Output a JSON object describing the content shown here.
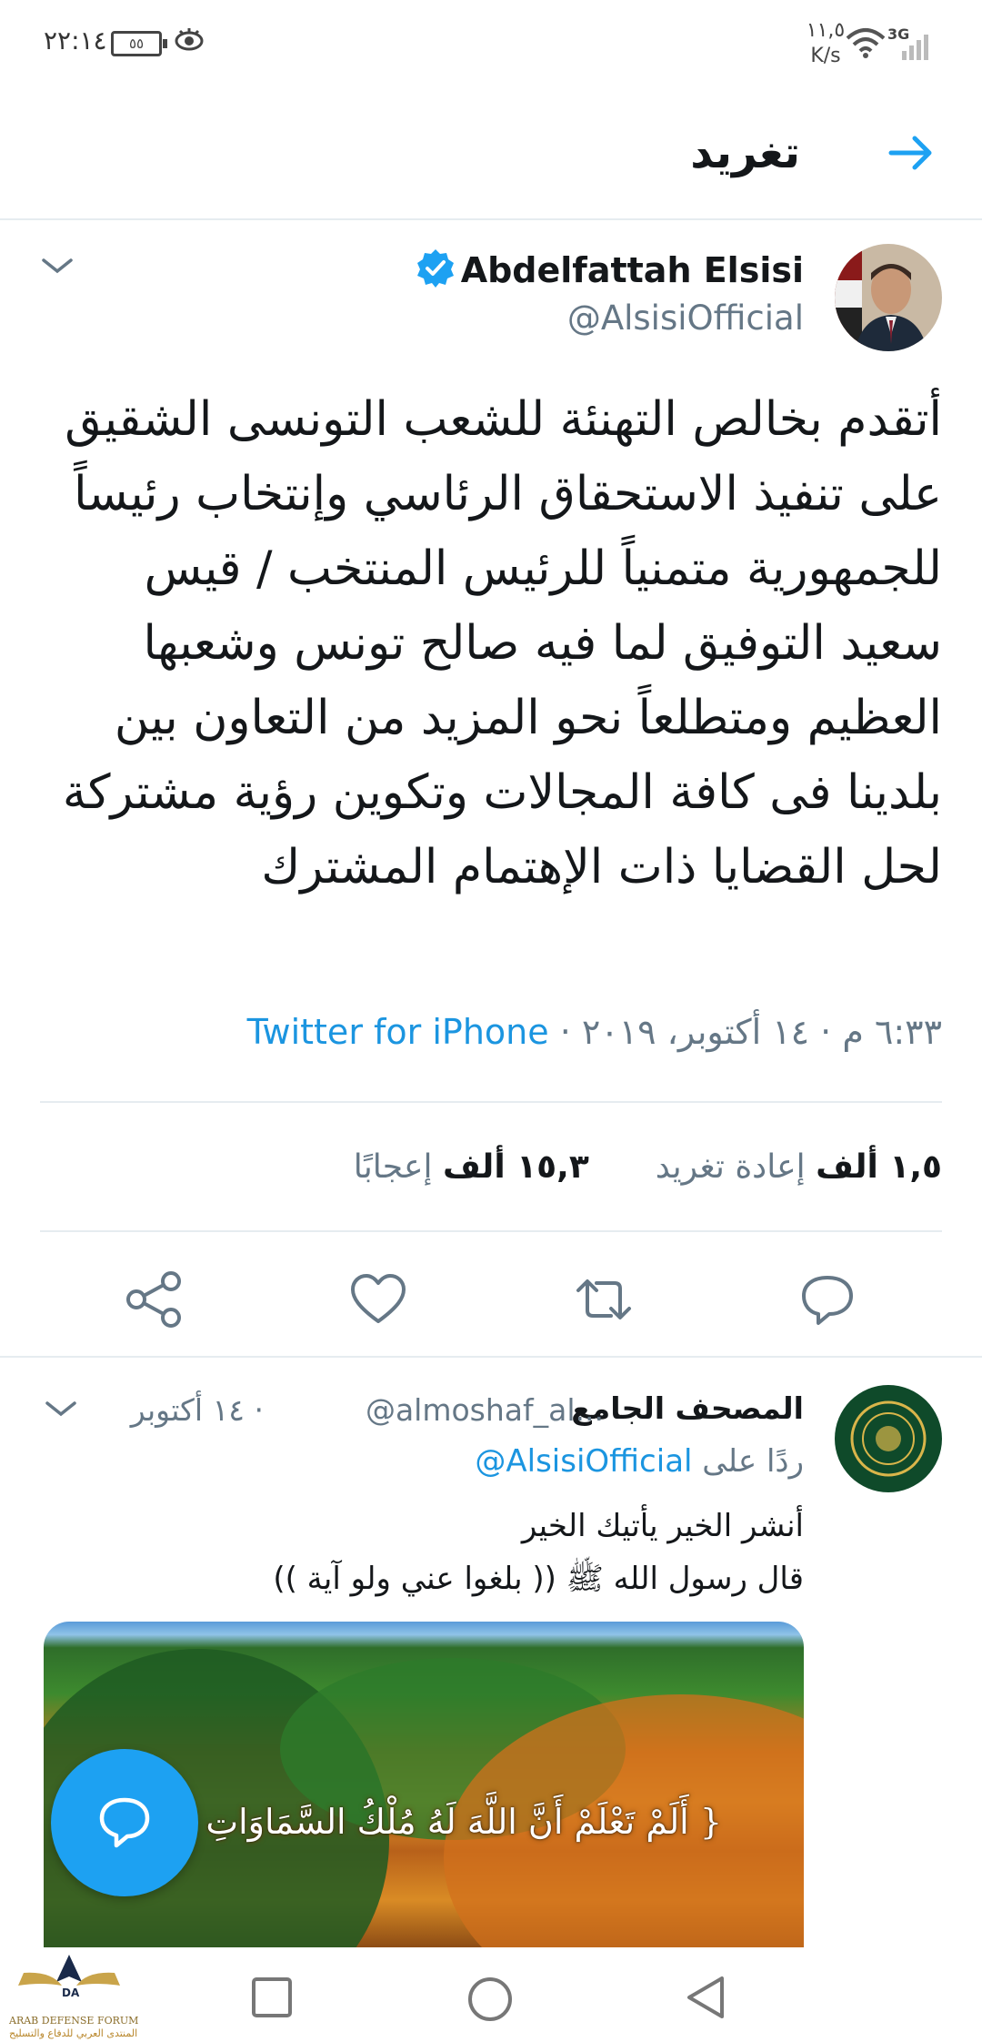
{
  "status_bar": {
    "time": "٢٢:١٤",
    "battery": "٥٥",
    "speed_value": "١١,٥",
    "speed_unit": "K/s",
    "network": "3G"
  },
  "header": {
    "title": "تغريد",
    "back_icon": "arrow-right-icon"
  },
  "tweet": {
    "name": "Abdelfattah Elsisi",
    "handle": "@AlsisiOfficial",
    "verified": true,
    "text": "أتقدم بخالص التهنئة للشعب التونسى الشقيق على تنفيذ الاستحقاق الرئاسي وإنتخاب رئيساً للجمهورية متمنياً للرئيس المنتخب / قيس سعيد التوفيق لما فيه صالح تونس وشعبها العظيم ومتطلعاً نحو المزيد من التعاون بين بلدينا فى كافة المجالات وتكوين رؤية مشتركة لحل القضايا ذات الإهتمام المشترك",
    "time": "٦:٣٣ م",
    "date": "١٤ أكتوبر، ٢٠١٩",
    "source": "Twitter for iPhone",
    "retweets_count": "١,٥ ألف",
    "retweets_label": "إعادة تغريد",
    "likes_count": "١٥,٣ ألف",
    "likes_label": "إعجابًا",
    "accent_color": "#1da1f2"
  },
  "reply": {
    "name": "المصحف الجامع",
    "handle": "@almoshaf_al...",
    "date": "١٤ أكتوبر",
    "replying_prefix": "ردًا على",
    "replying_to": "@AlsisiOfficial",
    "line1": "أنشر الخير يأتيك الخير",
    "line2": "قال رسول الله ﷺ (( بلغوا عني ولو آية ))",
    "media_verse": "{ أَلَمْ تَعْلَمْ أَنَّ اللَّهَ لَهُ مُلْكُ السَّمَاوَاتِ وَالْأَرْ"
  },
  "watermark": {
    "en": "ARAB DEFENSE FORUM",
    "ar": "المنتدى العربي للدفاع والتسليح",
    "logo_text": "DA"
  }
}
